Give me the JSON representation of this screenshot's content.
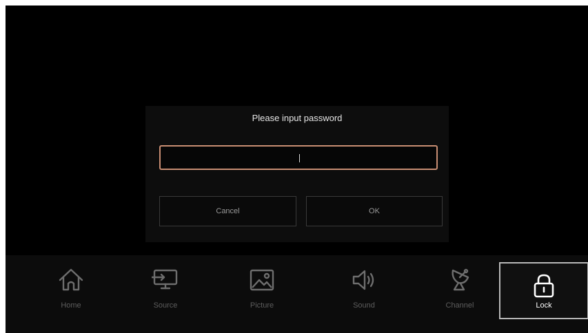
{
  "dialog": {
    "title": "Please input password",
    "cancel_label": "Cancel",
    "ok_label": "OK"
  },
  "menu": {
    "items": [
      {
        "label": "Home",
        "icon": "home-icon"
      },
      {
        "label": "Source",
        "icon": "source-icon"
      },
      {
        "label": "Picture",
        "icon": "picture-icon"
      },
      {
        "label": "Sound",
        "icon": "sound-icon"
      },
      {
        "label": "Channel",
        "icon": "channel-icon"
      },
      {
        "label": "Lock",
        "icon": "lock-icon",
        "selected": true
      }
    ]
  },
  "colors": {
    "background": "#000000",
    "focus_border": "#c98e73",
    "selected_border": "#b9b9b9",
    "dim_text": "#5e5e5e"
  }
}
